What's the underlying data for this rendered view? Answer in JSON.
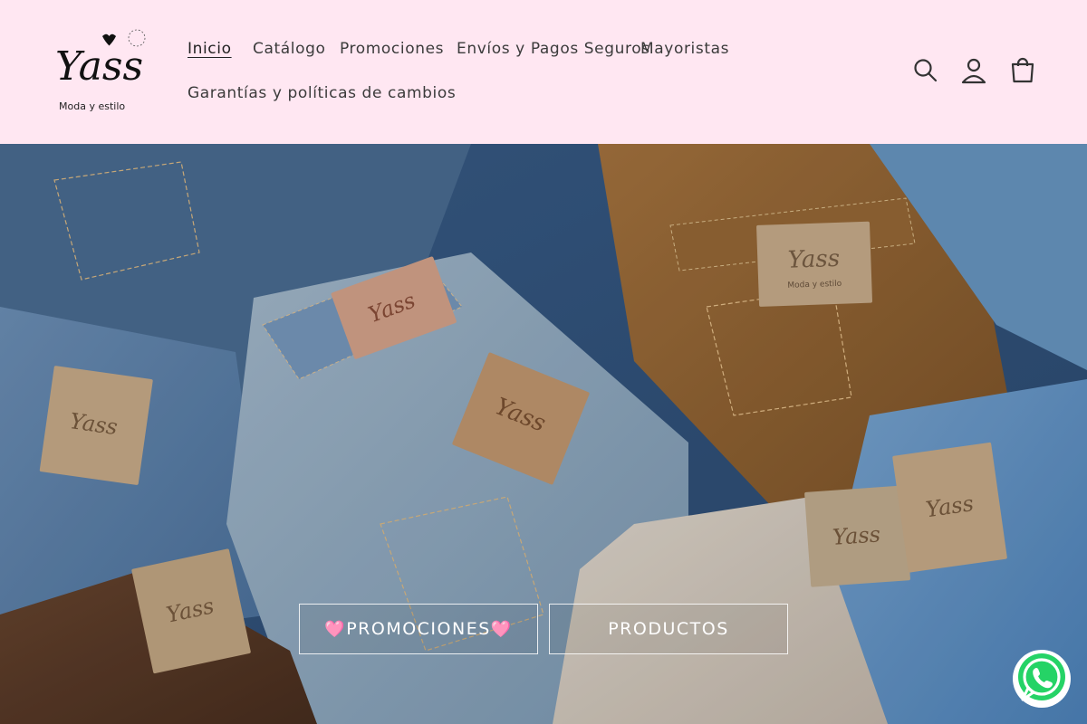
{
  "brand": {
    "logo_text": "Yass",
    "tagline": "Moda y estilo"
  },
  "nav": {
    "items": [
      {
        "label": "Inicio",
        "active": true
      },
      {
        "label": "Catálogo",
        "active": false
      },
      {
        "label": "Promociones",
        "active": false
      },
      {
        "label": "Envíos y Pagos Seguros",
        "active": false
      },
      {
        "label": "Mayoristas",
        "active": false
      },
      {
        "label": "Garantías y políticas de cambios",
        "active": false
      }
    ]
  },
  "header_icons": [
    "search-icon",
    "account-icon",
    "cart-icon"
  ],
  "hero": {
    "buttons": {
      "promo": {
        "heart": "🩷",
        "label": "PROMOCIONES"
      },
      "products": {
        "label": "PRODUCTOS"
      }
    },
    "label_text": "Yass",
    "label_tagline": "Moda y estilo"
  },
  "whatsapp": {
    "icon": "whatsapp-icon",
    "color": "#25d366"
  },
  "colors": {
    "header_bg": "#ffe7f2",
    "nav_text": "#3b3b3b",
    "accent_heart": "#ff7fb0"
  }
}
